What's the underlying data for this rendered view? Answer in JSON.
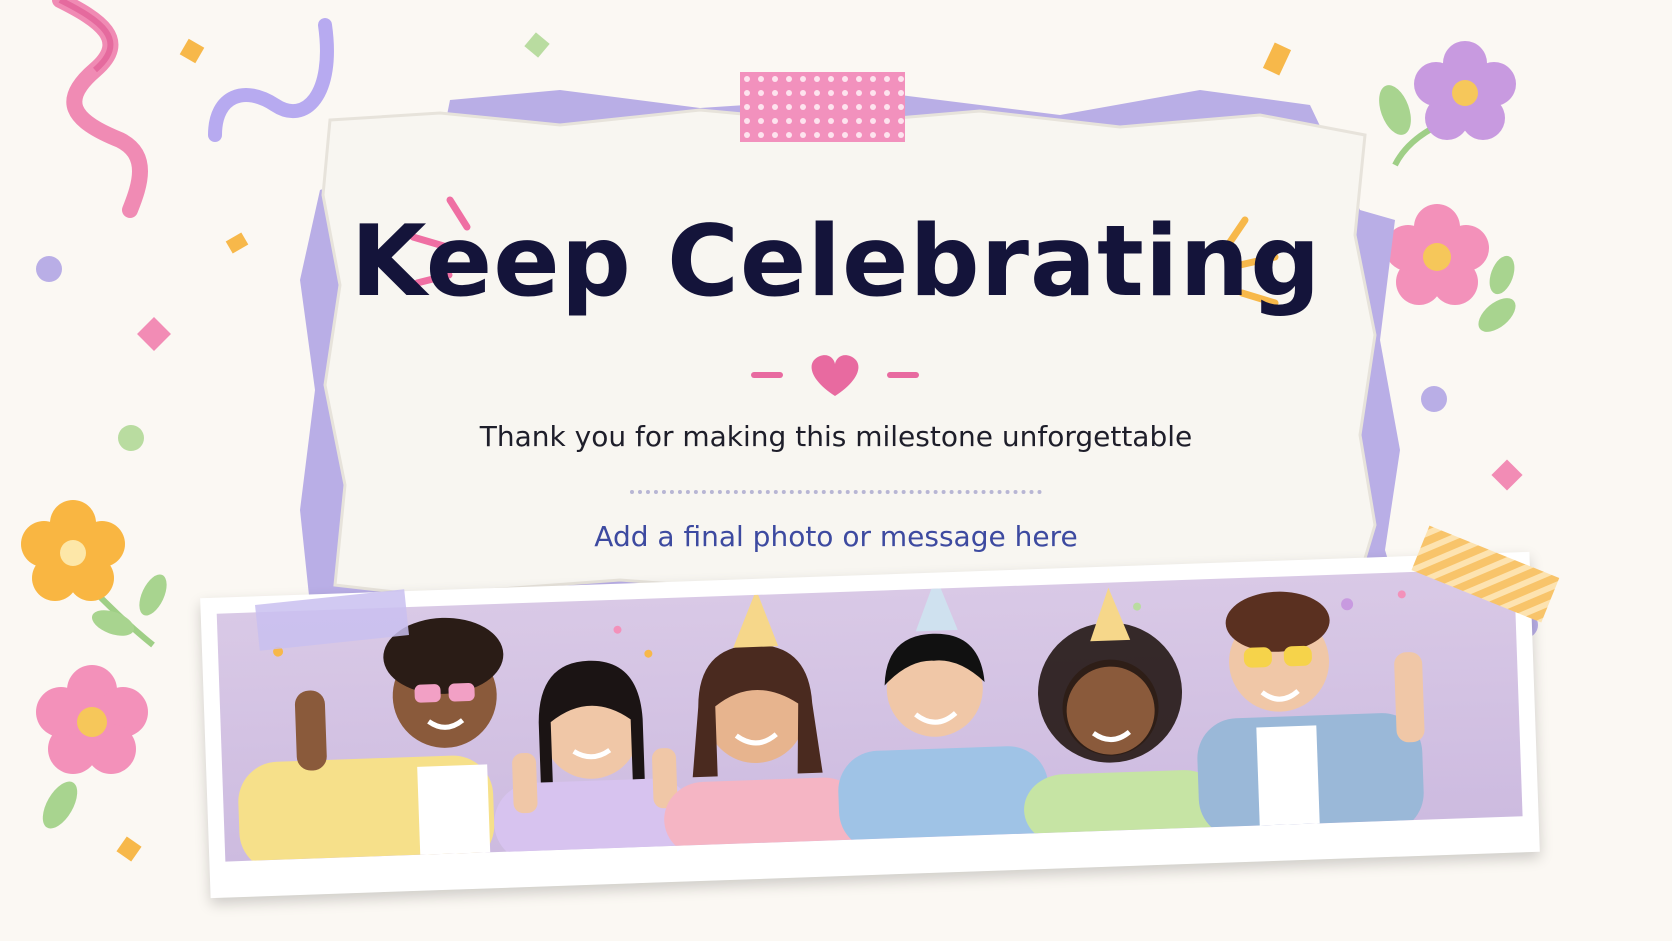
{
  "title": "Keep Celebrating",
  "subtitle": "Thank you for making this milestone unforgettable",
  "placeholder": "Add a final photo or message here",
  "colors": {
    "background": "#fbf8f3",
    "title": "#14143a",
    "accent_pink": "#e86aa0",
    "accent_lavender": "#b9aee6",
    "accent_orange": "#f7b84a",
    "link": "#3d4aa0"
  },
  "icons": [
    "heart-icon",
    "spark-lines-icon",
    "flower-icon",
    "ribbon-icon",
    "confetti-icon",
    "washi-tape-icon"
  ]
}
